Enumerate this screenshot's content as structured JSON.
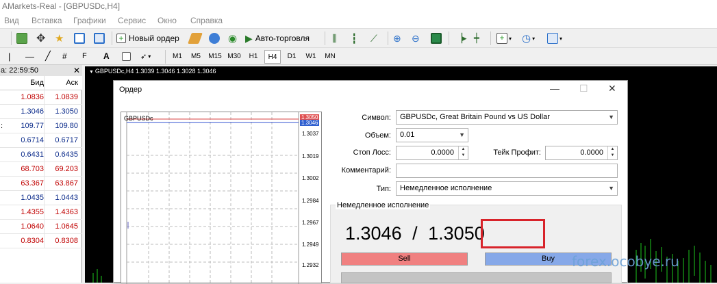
{
  "window": {
    "title": "AMarkets-Real - [GBPUSDc,H4]"
  },
  "menu": [
    "Вид",
    "Вставка",
    "Графики",
    "Сервис",
    "Окно",
    "Справка"
  ],
  "toolbar": {
    "new_order": "Новый ордер",
    "autotrading": "Авто-торговля"
  },
  "drawing_tools": {
    "text_tool": "A"
  },
  "timeframes": {
    "items": [
      "M1",
      "M5",
      "M15",
      "M30",
      "H1",
      "H4",
      "D1",
      "W1",
      "MN"
    ],
    "active": "H4"
  },
  "market_watch": {
    "header": "a: 22:59:50",
    "col_bid": "Бид",
    "col_ask": "Аск",
    "rows": [
      {
        "mark": "",
        "bid": "1.0836",
        "ask": "1.0839",
        "color": "#c00000"
      },
      {
        "mark": "",
        "bid": "1.3046",
        "ask": "1.3050",
        "color": "#0a2a8a"
      },
      {
        "mark": ":",
        "bid": "109.77",
        "ask": "109.80",
        "color": "#0a2a8a"
      },
      {
        "mark": "",
        "bid": "0.6714",
        "ask": "0.6717",
        "color": "#0a2a8a"
      },
      {
        "mark": "",
        "bid": "0.6431",
        "ask": "0.6435",
        "color": "#0a2a8a"
      },
      {
        "mark": "",
        "bid": "68.703",
        "ask": "69.203",
        "color": "#c00000"
      },
      {
        "mark": "",
        "bid": "63.367",
        "ask": "63.867",
        "color": "#c00000"
      },
      {
        "mark": "",
        "bid": "1.0435",
        "ask": "1.0443",
        "color": "#0a2a8a"
      },
      {
        "mark": "",
        "bid": "1.4355",
        "ask": "1.4363",
        "color": "#c00000"
      },
      {
        "mark": "",
        "bid": "1.0640",
        "ask": "1.0645",
        "color": "#c00000"
      },
      {
        "mark": "",
        "bid": "0.8304",
        "ask": "0.8308",
        "color": "#c00000"
      }
    ]
  },
  "chart": {
    "label": "GBPUSDc,H4  1.3039 1.3046 1.3028 1.3046"
  },
  "dialog": {
    "title": "Ордер",
    "mini_chart": {
      "symbol": "GBPUSDc",
      "price_ask": "1.3050",
      "price_bid": "1.3046",
      "ticks": [
        "1.3037",
        "1.3019",
        "1.3002",
        "1.2984",
        "1.2967",
        "1.2949",
        "1.2932"
      ]
    },
    "symbol_label": "Символ:",
    "symbol_value": "GBPUSDc, Great Britain Pound vs US Dollar",
    "volume_label": "Объем:",
    "volume_value": "0.01",
    "sl_label": "Стоп Лосс:",
    "sl_value": "0.0000",
    "tp_label": "Тейк Профит:",
    "tp_value": "0.0000",
    "comment_label": "Комментарий:",
    "comment_value": "",
    "type_label": "Тип:",
    "type_value": "Немедленное исполнение",
    "group_title": "Немедленное исполнение",
    "bid": "1.3046",
    "separator": "/",
    "ask": "1.3050",
    "sell": "Sell",
    "buy": "Buy"
  },
  "watermark": "forex.ocobye.ru",
  "colors": {
    "sell": "#f08080",
    "buy": "#86a8e8",
    "highlight": "#d8232a"
  }
}
